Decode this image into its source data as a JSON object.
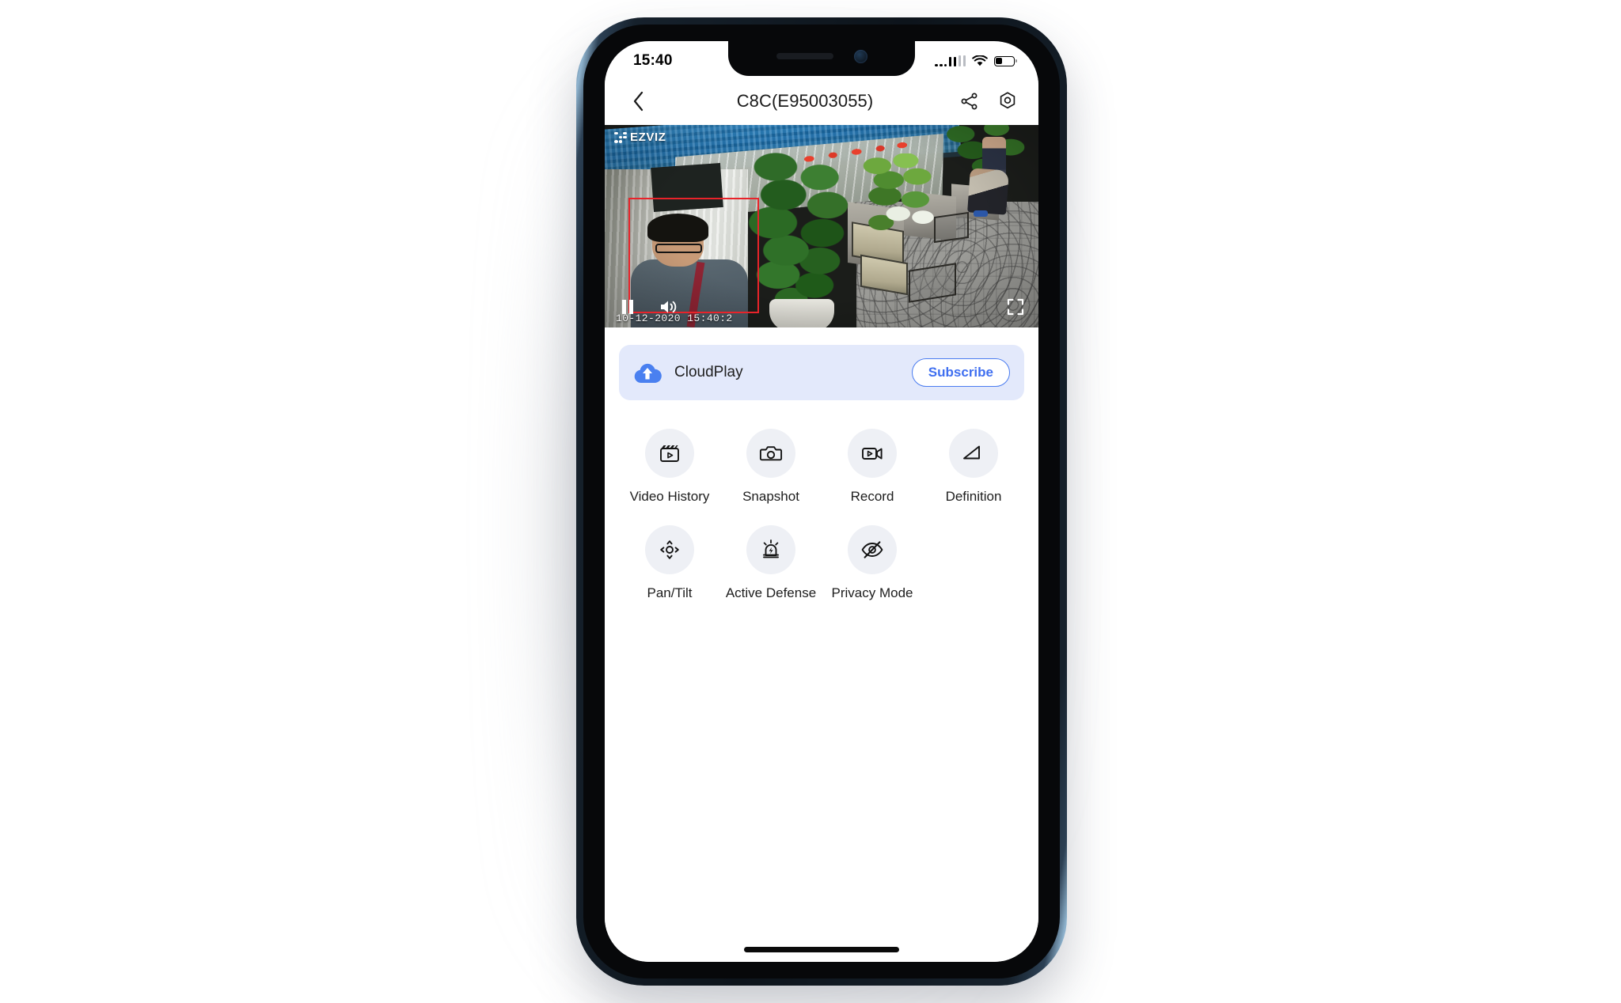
{
  "status_bar": {
    "time": "15:40",
    "signal_icon": "cellular-signal-icon",
    "wifi_icon": "wifi-icon",
    "battery_icon": "battery-icon",
    "battery_level": "35"
  },
  "header": {
    "back_icon": "chevron-left-icon",
    "title": "C8C(E95003055)",
    "share_icon": "share-icon",
    "settings_icon": "gear-icon"
  },
  "player": {
    "brand_logo": "ezviz-logo",
    "brand_text": "EZVIZ",
    "timestamp": "10-12-2020 15:40:2",
    "pause_icon": "pause-icon",
    "volume_icon": "volume-on-icon",
    "fullscreen_icon": "fullscreen-icon",
    "detection_box": "motion-detection-box"
  },
  "cloudplay": {
    "icon": "cloud-upload-icon",
    "label": "CloudPlay",
    "subscribe_label": "Subscribe",
    "accent_color": "#3f6ff0",
    "background_color": "#e3e9fb"
  },
  "features": [
    {
      "label": "Video History",
      "icon": "film-clapper-icon"
    },
    {
      "label": "Snapshot",
      "icon": "camera-icon"
    },
    {
      "label": "Record",
      "icon": "video-camera-icon"
    },
    {
      "label": "Definition",
      "icon": "definition-icon"
    },
    {
      "label": "Pan/Tilt",
      "icon": "pan-tilt-icon"
    },
    {
      "label": "Active Defense",
      "icon": "siren-alarm-icon"
    },
    {
      "label": "Privacy Mode",
      "icon": "eye-off-icon"
    }
  ]
}
